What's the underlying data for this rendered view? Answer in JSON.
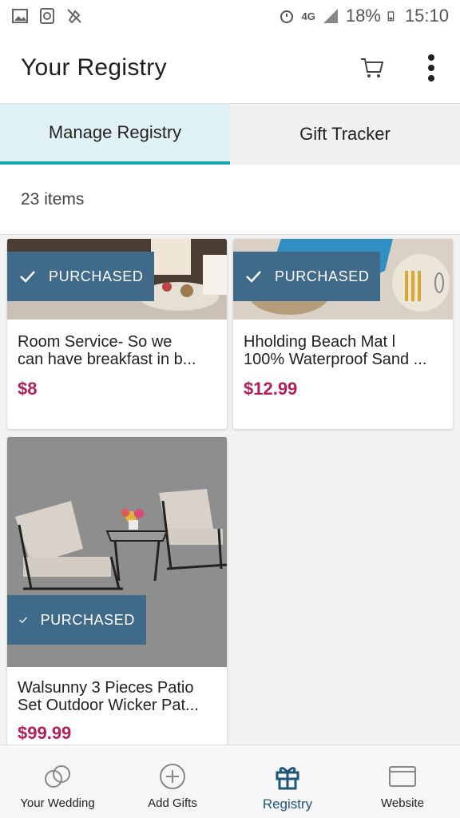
{
  "status_bar": {
    "left_icons": [
      "image-icon",
      "sync-icon",
      "silent-icon"
    ],
    "network": "4G",
    "battery": "18%",
    "time": "15:10"
  },
  "app_bar": {
    "title": "Your Registry"
  },
  "tabs": [
    {
      "label": "Manage Registry",
      "active": true
    },
    {
      "label": "Gift Tracker",
      "active": false
    }
  ],
  "items_count": "23 items",
  "products": [
    {
      "line1": "Room Service- So we",
      "line2": "can have breakfast in b...",
      "price": "$8",
      "status": "PURCHASED"
    },
    {
      "line1": "Hholding Beach Mat l",
      "line2": "100% Waterproof Sand ...",
      "price": "$12.99",
      "status": "PURCHASED"
    },
    {
      "line1": "Walsunny 3 Pieces Patio",
      "line2": "Set Outdoor Wicker Pat...",
      "price": "$99.99",
      "status": "PURCHASED"
    }
  ],
  "bottom_nav": [
    {
      "label": "Your Wedding",
      "icon": "rings-icon",
      "active": false
    },
    {
      "label": "Add Gifts",
      "icon": "plus-circle-icon",
      "active": false
    },
    {
      "label": "Registry",
      "icon": "gift-icon",
      "active": true
    },
    {
      "label": "Website",
      "icon": "browser-icon",
      "active": false
    }
  ],
  "colors": {
    "accent": "#1aa3b3",
    "badge": "#3f6a8a",
    "price": "#b02257",
    "nav_active": "#1f5878"
  }
}
